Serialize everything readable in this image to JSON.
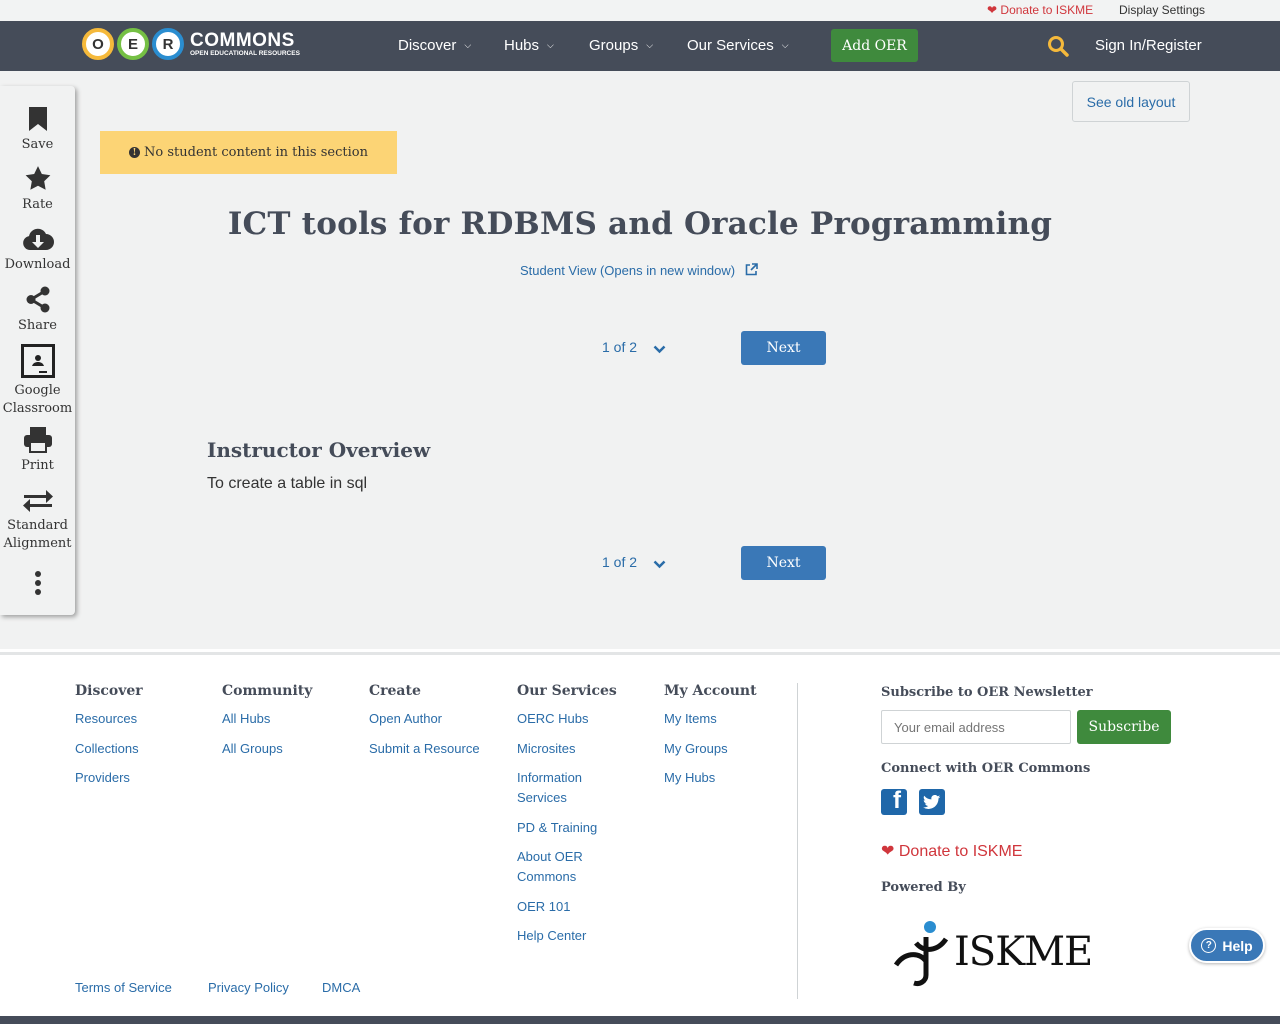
{
  "utility": {
    "donate": "Donate to ISKME",
    "display_settings": "Display Settings"
  },
  "nav": {
    "logo_letters": [
      "O",
      "E",
      "R"
    ],
    "logo_word": "COMMONS",
    "logo_tagline": "OPEN EDUCATIONAL RESOURCES",
    "items": [
      {
        "label": "Discover"
      },
      {
        "label": "Hubs"
      },
      {
        "label": "Groups"
      },
      {
        "label": "Our Services"
      }
    ],
    "add_oer": "Add OER",
    "sign_in": "Sign In/Register"
  },
  "sidebar": {
    "items": [
      {
        "label": "Save",
        "icon": "bookmark-icon"
      },
      {
        "label": "Rate",
        "icon": "star-icon"
      },
      {
        "label": "Download",
        "icon": "cloud-download-icon"
      },
      {
        "label": "Share",
        "icon": "share-icon"
      },
      {
        "label": "Google",
        "label2": "Classroom",
        "icon": "google-classroom-icon"
      },
      {
        "label": "Print",
        "icon": "print-icon"
      },
      {
        "label": "Standard",
        "label2": "Alignment",
        "icon": "exchange-arrows-icon"
      }
    ]
  },
  "main": {
    "see_old_layout": "See old layout",
    "notice": "No student content in this section",
    "title": "ICT tools for RDBMS and Oracle Programming",
    "student_view": "Student View (Opens in new window)",
    "pager_label": "1 of 2",
    "next_label": "Next",
    "overview_heading": "Instructor Overview",
    "overview_text": "To create a table in sql"
  },
  "footer": {
    "columns": [
      {
        "heading": "Discover",
        "links": [
          "Resources",
          "Collections",
          "Providers"
        ]
      },
      {
        "heading": "Community",
        "links": [
          "All Hubs",
          "All Groups"
        ]
      },
      {
        "heading": "Create",
        "links": [
          "Open Author",
          "Submit a Resource"
        ]
      },
      {
        "heading": "Our Services",
        "links": [
          "OERC Hubs",
          "Microsites",
          "Information Services",
          "PD & Training",
          "About OER Commons",
          "OER 101",
          "Help Center"
        ]
      },
      {
        "heading": "My Account",
        "links": [
          "My Items",
          "My Groups",
          "My Hubs"
        ]
      }
    ],
    "newsletter_heading": "Subscribe to OER Newsletter",
    "email_placeholder": "Your email address",
    "subscribe": "Subscribe",
    "connect_heading": "Connect with OER Commons",
    "donate": "Donate to ISKME",
    "powered_by": "Powered By",
    "iskme_logo_text": "ISKME",
    "legal": [
      "Terms of Service",
      "Privacy Policy",
      "DMCA"
    ]
  },
  "help": "Help",
  "colors": {
    "nav_bg": "#454c59",
    "accent_green": "#3f8a3d",
    "link_blue": "#2a6ca8",
    "button_blue": "#3a78b7",
    "notice_yellow": "#fcd475",
    "donate_red": "#d0363c"
  }
}
